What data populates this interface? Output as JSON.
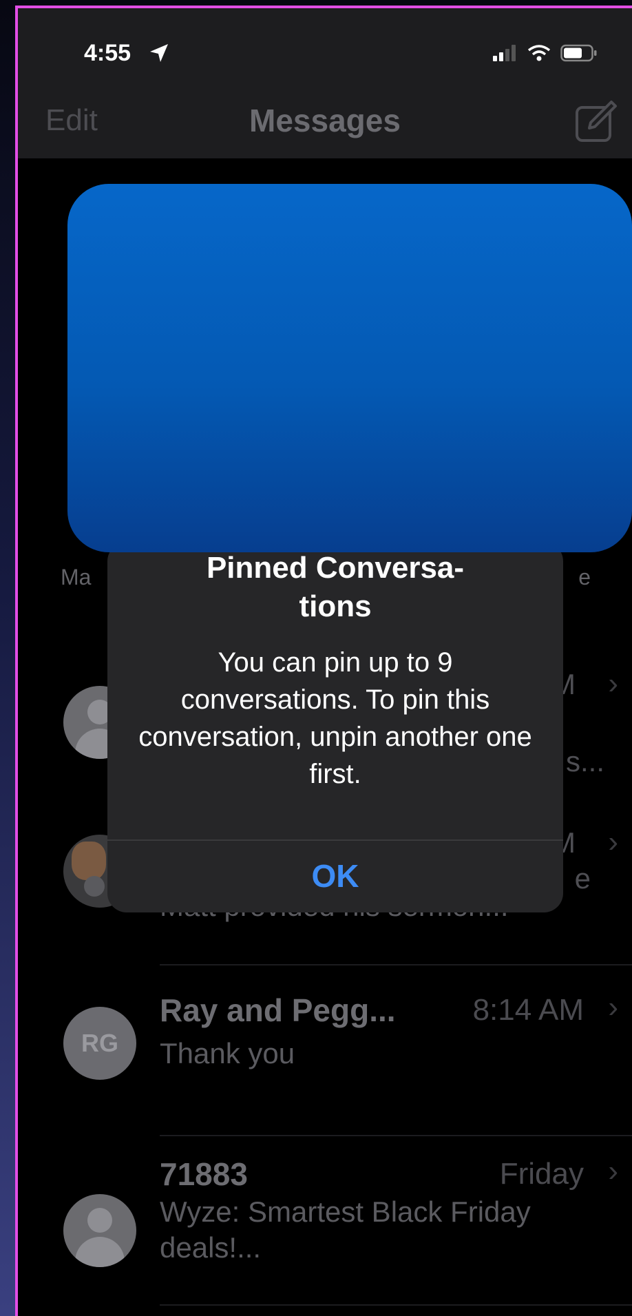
{
  "status": {
    "time": "4:55"
  },
  "nav": {
    "edit": "Edit",
    "title": "Messages"
  },
  "pinned": {
    "left_fragment": "Ma",
    "right_fragment": "e"
  },
  "alert": {
    "title": "Pinned Conversa-\ntions",
    "message": "You can pin up to 9 conversations. To pin this conversation, unpin another one first.",
    "ok": "OK"
  },
  "rows": [
    {
      "time_fragment": "M",
      "preview_fragment": "s..."
    },
    {
      "time_fragment": "M",
      "preview_fragment": "e",
      "preview": "Matt provided his sermon..."
    },
    {
      "name": "Ray and Pegg...",
      "time": "8:14 AM",
      "preview": "Thank you",
      "initials": "RG"
    },
    {
      "name": "71883",
      "time": "Friday",
      "preview": "Wyze: Smartest Black Friday deals!..."
    }
  ],
  "colors": {
    "accent": "#3d8cf5",
    "border": "#e24ee6",
    "redaction": "#0459b3"
  }
}
